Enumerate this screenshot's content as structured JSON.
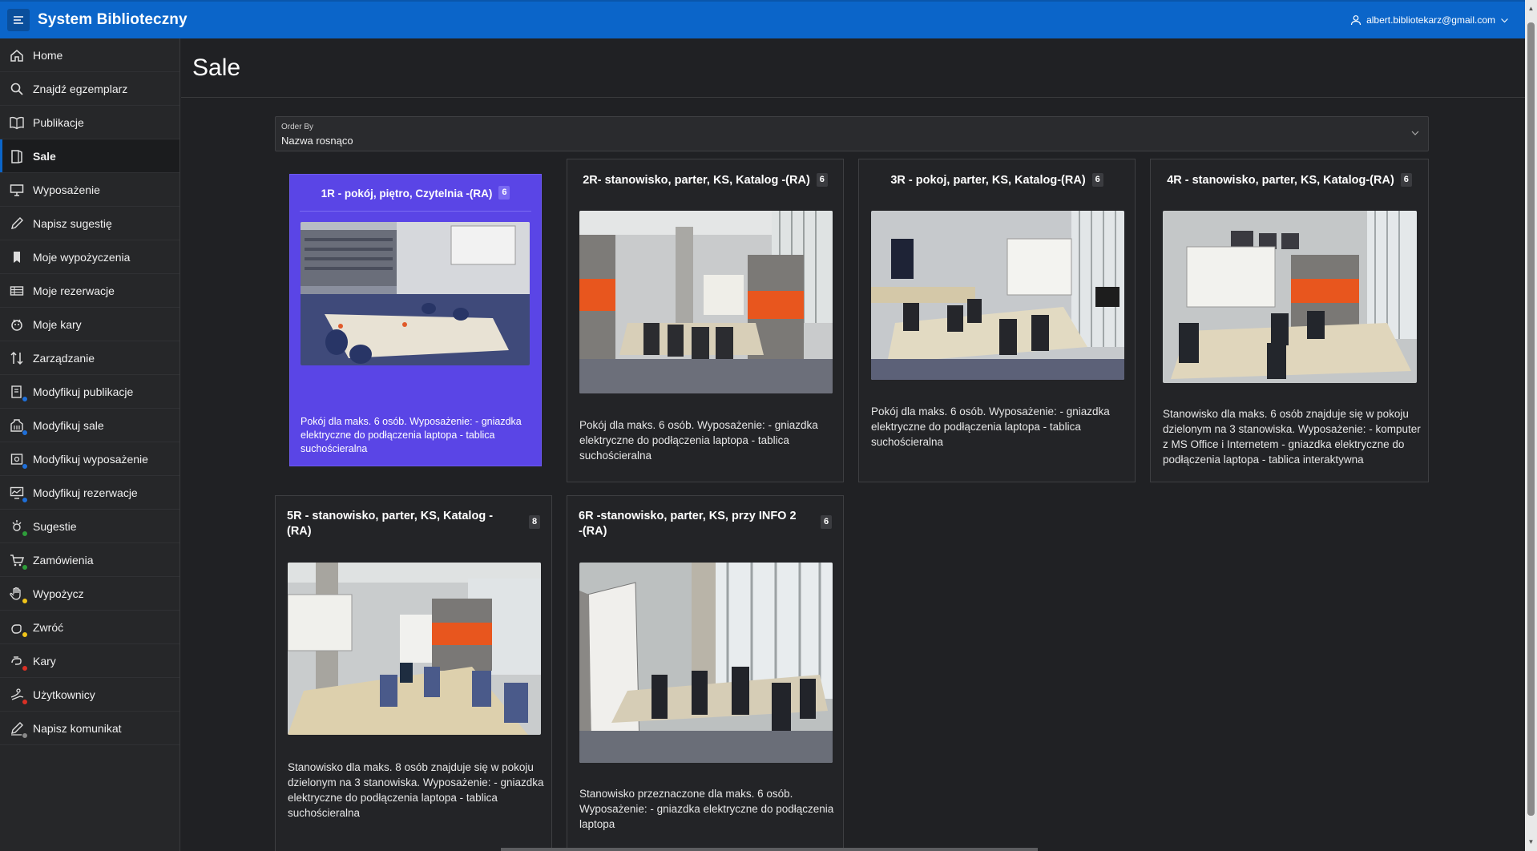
{
  "app": {
    "title": "System Biblioteczny",
    "user_email": "albert.bibliotekarz@gmail.com"
  },
  "sidebar": {
    "items": [
      {
        "label": "Home",
        "icon": "home-icon"
      },
      {
        "label": "Znajdź egzemplarz",
        "icon": "search-icon"
      },
      {
        "label": "Publikacje",
        "icon": "book-open-icon"
      },
      {
        "label": "Sale",
        "icon": "room-icon",
        "active": true
      },
      {
        "label": "Wyposażenie",
        "icon": "monitor-icon"
      },
      {
        "label": "Napisz sugestię",
        "icon": "pencil-icon"
      },
      {
        "label": "Moje wypożyczenia",
        "icon": "bookmark-icon"
      },
      {
        "label": "Moje rezerwacje",
        "icon": "table-icon"
      },
      {
        "label": "Moje kary",
        "icon": "penalty-icon"
      },
      {
        "label": "Zarządzanie",
        "icon": "sort-arrows-icon"
      },
      {
        "label": "Modyfikuj publikacje",
        "icon": "edit-book-icon"
      },
      {
        "label": "Modyfikuj sale",
        "icon": "edit-building-icon"
      },
      {
        "label": "Modyfikuj wyposażenie",
        "icon": "edit-equipment-icon"
      },
      {
        "label": "Modyfikuj rezerwacje",
        "icon": "edit-chart-icon"
      },
      {
        "label": "Sugestie",
        "icon": "suggestions-icon"
      },
      {
        "label": "Zamówienia",
        "icon": "cart-icon"
      },
      {
        "label": "Wypożycz",
        "icon": "hand-icon"
      },
      {
        "label": "Zwróć",
        "icon": "return-hand-icon"
      },
      {
        "label": "Kary",
        "icon": "fine-icon"
      },
      {
        "label": "Użytkownicy",
        "icon": "users-icon"
      },
      {
        "label": "Napisz komunikat",
        "icon": "write-message-icon"
      }
    ]
  },
  "page": {
    "title": "Sale"
  },
  "order_by": {
    "label": "Order By",
    "value": "Nazwa rosnąco"
  },
  "cards": [
    {
      "title": "1R - pokój, piętro, Czytelnia -(RA)",
      "count": "6",
      "description": "Pokój dla maks. 6 osób. Wyposażenie: - gniazdka elektryczne do podłączenia laptopa - tablica suchościeralna"
    },
    {
      "title": "2R- stanowisko, parter, KS, Katalog -(RA)",
      "count": "6",
      "description": "Pokój dla maks. 6 osób. Wyposażenie: - gniazdka elektryczne do podłączenia laptopa - tablica suchościeralna"
    },
    {
      "title": "3R - pokoj, parter, KS, Katalog-(RA)",
      "count": "6",
      "description": "Pokój dla maks. 6 osób. Wyposażenie: - gniazdka elektryczne do podłączenia laptopa - tablica suchościeralna"
    },
    {
      "title": "4R - stanowisko, parter, KS, Katalog-(RA)",
      "count": "6",
      "description": "Stanowisko dla maks. 6 osób znajduje się w pokoju dzielonym na 3 stanowiska. Wyposażenie: - komputer z MS Office i Internetem - gniazdka elektryczne do podłączenia laptopa - tablica interaktywna"
    },
    {
      "title": "5R - stanowisko, parter, KS, Katalog -(RA)",
      "count": "8",
      "description": "Stanowisko dla maks. 8 osób znajduje się w pokoju dzielonym na 3 stanowiska. Wyposażenie: - gniazdka elektryczne do podłączenia laptopa - tablica suchościeralna"
    },
    {
      "title": "6R -stanowisko, parter, KS, przy INFO 2 -(RA)",
      "count": "6",
      "description": "Stanowisko przeznaczone dla maks. 6 osób. Wyposażenie: - gniazdka elektryczne do podłączenia laptopa"
    }
  ],
  "colors": {
    "header": "#0b65c9",
    "selected_card": "#5a45e6",
    "background": "#202124"
  }
}
